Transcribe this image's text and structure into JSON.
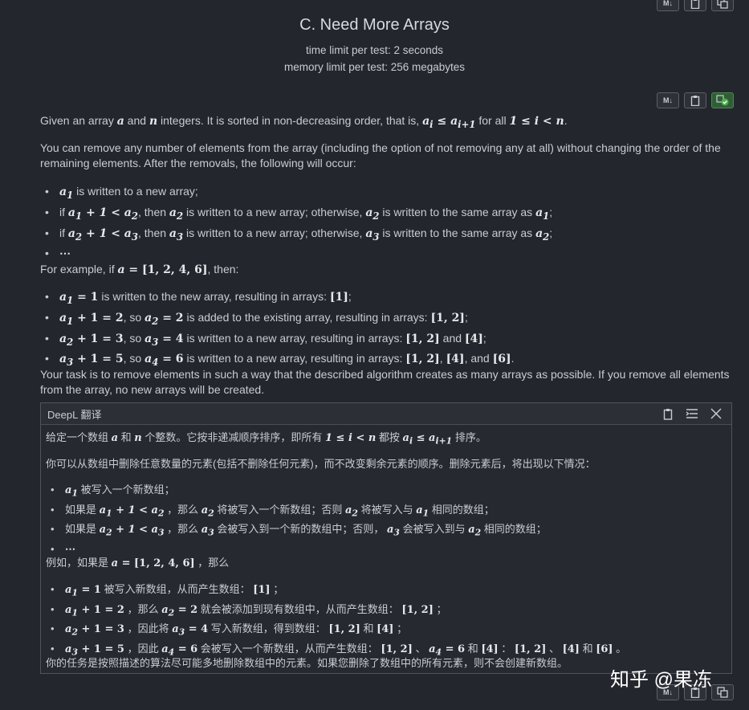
{
  "header": {
    "title": "C. Need More Arrays",
    "time_limit": "time limit per test: 2 seconds",
    "memory_limit": "memory limit per test: 256 megabytes"
  },
  "toolbar": {
    "md_label": "M↓"
  },
  "statement": {
    "p1_a": "Given an array ",
    "p1_b": " and ",
    "p1_c": " integers. It is sorted in non-decreasing order, that is, ",
    "p1_d": " for all ",
    "p2": "You can remove any number of elements from the array (including the option of not removing any at all) without changing the order of the remaining elements. After the removals, the following will occur:",
    "b1": " is written to a new array;",
    "b2_a": "if ",
    "b2_b": ", then ",
    "b2_c": " is written to a new array; otherwise, ",
    "b2_d": " is written to the same array as ",
    "b3_a": "if ",
    "b3_b": ", then ",
    "b3_c": " is written to a new array; otherwise, ",
    "b3_d": " is written to the same array as ",
    "ex_a": "For example, if ",
    "ex_b": ", then:",
    "e1": " is written to the new array, resulting in arrays: ",
    "e2_a": ", so ",
    "e2_b": " is added to the existing array, resulting in arrays: ",
    "e3_a": ", so ",
    "e3_b": " is written to a new array, resulting in arrays: ",
    "e3_c": " and ",
    "e4_a": ", so ",
    "e4_b": " is written to a new array, resulting in arrays: ",
    "e4_c": ", and ",
    "task": "Your task is to remove elements in such a way that the described algorithm creates as many arrays as possible. If you remove all elements from the array, no new arrays will be created."
  },
  "deepl": {
    "title": "DeepL 翻译",
    "l1_a": "给定一个数组 ",
    "l1_b": " 和 ",
    "l1_c": " 个整数。它按非递减顺序排序，即所有 ",
    "l1_d": " 都按 ",
    "l1_e": " 排序。",
    "l2": "你可以从数组中删除任意数量的元素(包括不删除任何元素)，而不改变剩余元素的顺序。删除元素后，将出现以下情况：",
    "z1": " 被写入一个新数组；",
    "z2_a": "如果是 ",
    "z2_b": " ，那么 ",
    "z2_c": " 将被写入一个新数组；否则 ",
    "z2_d": " 将被写入与 ",
    "z2_e": " 相同的数组；",
    "z3_a": "如果是 ",
    "z3_b": " ，那么 ",
    "z3_c": " 会被写入到一个新的数组中；否则， ",
    "z3_d": " 会被写入到与 ",
    "z3_e": " 相同的数组；",
    "ex_a": "例如，如果是 ",
    "ex_b": " ，那么",
    "y1": " 被写入新数组，从而产生数组： ",
    "y2_a": " ，那么 ",
    "y2_b": " 就会被添加到现有数组中，从而产生数组： ",
    "y3_a": " ，因此将 ",
    "y3_b": " 写入新数组，得到数组： ",
    "y3_c": " 和 ",
    "y4_a": " ，因此 ",
    "y4_b": " 会被写入一个新数组，从而产生数组： ",
    "y4_c": " 、 ",
    "y4_d": " 和 ",
    "y4_e": " ： ",
    "y4_f": " 、 ",
    "y4_g": " 和 ",
    "task": "你的任务是按照描述的算法尽可能多地删除数组中的元素。如果您删除了数组中的所有元素，则不会创建新数组。"
  },
  "watermark": "知乎 @果冻"
}
